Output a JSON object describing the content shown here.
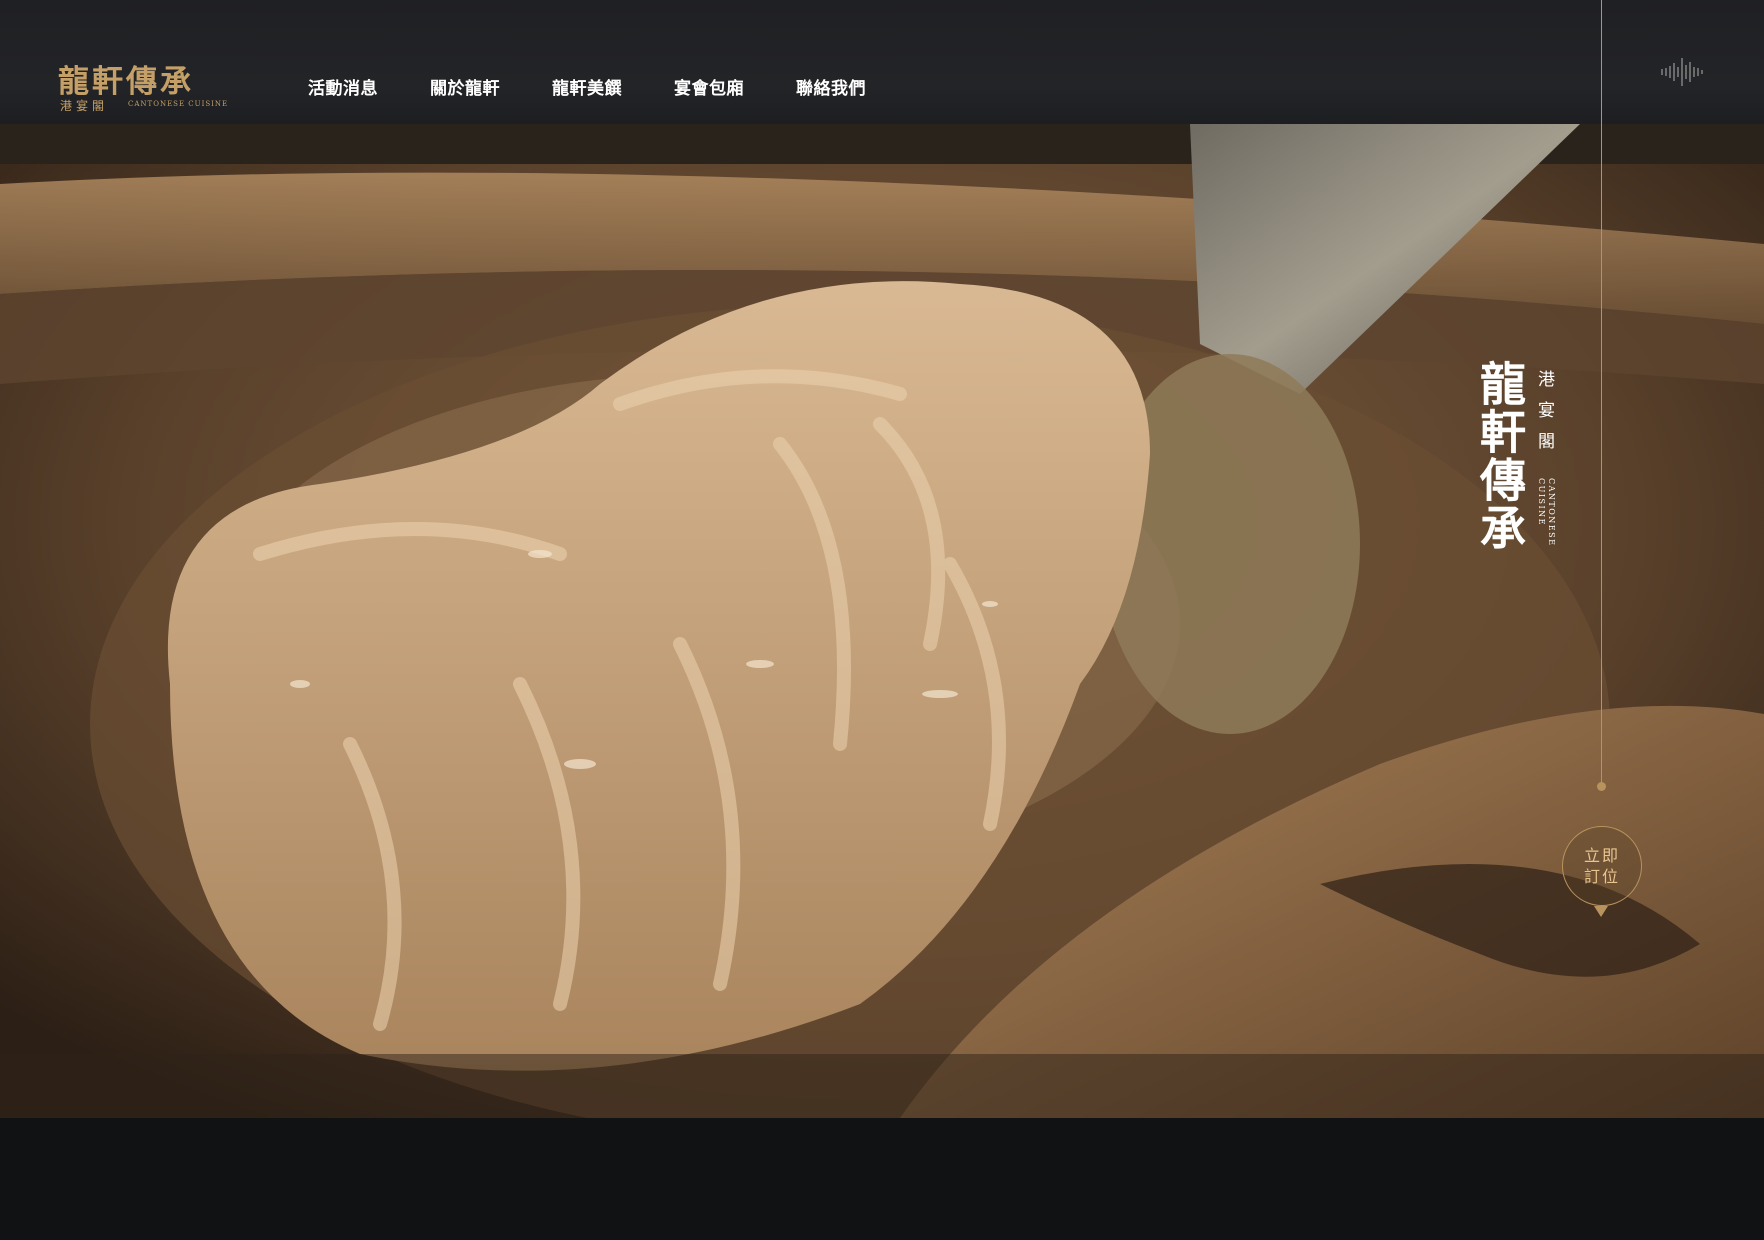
{
  "brand": {
    "title": "龍軒傳承",
    "sub_zh": "港宴閣",
    "sub_en": "CANTONESE CUISINE"
  },
  "nav": {
    "items": [
      {
        "label": "活動消息"
      },
      {
        "label": "關於龍軒"
      },
      {
        "label": "龍軒美饌"
      },
      {
        "label": "宴會包廂"
      },
      {
        "label": "聯絡我們"
      }
    ]
  },
  "side_brand": {
    "title": "龍軒傳承",
    "sub_zh": "港宴閣",
    "sub_en": "CANTONESE\nCUISINE"
  },
  "order_button": {
    "label": "立即\n訂位"
  },
  "icons": {
    "sound": "sound-wave-icon",
    "order_arrow": "triangle-down-icon"
  },
  "colors": {
    "gold": "#c4a068",
    "header_bg": "#1f2023",
    "page_bg": "#111214"
  }
}
